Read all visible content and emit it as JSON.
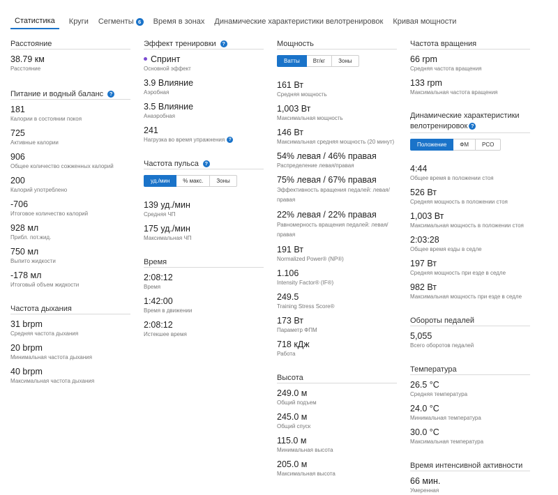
{
  "tabs": [
    {
      "label": "Статистика"
    },
    {
      "label": "Круги"
    },
    {
      "label": "Сегменты",
      "badge": "6"
    },
    {
      "label": "Время в зонах"
    },
    {
      "label": "Динамические характеристики велотренировок"
    },
    {
      "label": "Кривая мощности"
    }
  ],
  "help_glyph": "?",
  "col1": {
    "distance": {
      "title": "Расстояние",
      "value": "38.79 км",
      "label": "Расстояние"
    },
    "nutrition": {
      "title": "Питание и водный баланс",
      "items": [
        {
          "value": "181",
          "label": "Калории в состоянии покоя"
        },
        {
          "value": "725",
          "label": "Активные калории"
        },
        {
          "value": "906",
          "label": "Общее количество сожженных калорий"
        },
        {
          "value": "200",
          "label": "Калорий употреблено"
        },
        {
          "value": "-706",
          "label": "Итоговое количество калорий"
        },
        {
          "value": "928 мл",
          "label": "Прибл. пот.жид."
        },
        {
          "value": "750 мл",
          "label": "Выпито жидкости"
        },
        {
          "value": "-178 мл",
          "label": "Итоговый объем жидкости"
        }
      ]
    },
    "breathing": {
      "title": "Частота дыхания",
      "items": [
        {
          "value": "31 brpm",
          "label": "Средняя частота дыхания"
        },
        {
          "value": "20 brpm",
          "label": "Минимальная частота дыхания"
        },
        {
          "value": "40 brpm",
          "label": "Максимальная частота дыхания"
        }
      ]
    }
  },
  "col2": {
    "effect": {
      "title": "Эффект тренировки",
      "primary": {
        "value": "Спринт",
        "label": "Основной эффект"
      },
      "items": [
        {
          "value": "3.9 Влияние",
          "label": "Аэробная"
        },
        {
          "value": "3.5 Влияние",
          "label": "Анаэробная"
        },
        {
          "value": "241",
          "label": "Нагрузка во время упражнения"
        }
      ]
    },
    "hr": {
      "title": "Частота пульса",
      "buttons": [
        "уд./мин",
        "% макс.",
        "Зоны"
      ],
      "items": [
        {
          "value": "139 уд./мин",
          "label": "Средняя ЧП"
        },
        {
          "value": "175 уд./мин",
          "label": "Максимальная ЧП"
        }
      ]
    },
    "time": {
      "title": "Время",
      "items": [
        {
          "value": "2:08:12",
          "label": "Время"
        },
        {
          "value": "1:42:00",
          "label": "Время в движении"
        },
        {
          "value": "2:08:12",
          "label": "Истекшее время"
        }
      ]
    }
  },
  "col3": {
    "power": {
      "title": "Мощность",
      "buttons": [
        "Ватты",
        "Вт/кг",
        "Зоны"
      ],
      "items": [
        {
          "value": "161 Вт",
          "label": "Средняя мощность"
        },
        {
          "value": "1,003 Вт",
          "label": "Максимальная мощность"
        },
        {
          "value": "146 Вт",
          "label": "Максимальная средняя мощность (20 минут)"
        },
        {
          "value": "54% левая / 46% правая",
          "label": "Распределение левая/правая"
        },
        {
          "value": "75% левая / 67% правая",
          "label": "Эффективность вращения педалей: левая/правая"
        },
        {
          "value": "22% левая / 22% правая",
          "label": "Равномерность вращения педалей: левая/правая"
        },
        {
          "value": "191 Вт",
          "label": "Normalized Power® (NP®)"
        },
        {
          "value": "1.106",
          "label": "Intensity Factor® (IF®)"
        },
        {
          "value": "249.5",
          "label": "Training Stress Score®"
        },
        {
          "value": "173 Вт",
          "label": "Параметр ФПМ"
        },
        {
          "value": "718 кДж",
          "label": "Работа"
        }
      ]
    },
    "elevation": {
      "title": "Высота",
      "items": [
        {
          "value": "249.0 м",
          "label": "Общий подъем"
        },
        {
          "value": "245.0 м",
          "label": "Общий спуск"
        },
        {
          "value": "115.0 м",
          "label": "Минимальная высота"
        },
        {
          "value": "205.0 м",
          "label": "Максимальная высота"
        }
      ]
    }
  },
  "col4": {
    "cadence": {
      "title": "Частота вращения",
      "items": [
        {
          "value": "66 rpm",
          "label": "Средняя частота вращения"
        },
        {
          "value": "133 rpm",
          "label": "Максимальная частота вращения"
        }
      ]
    },
    "dynamics": {
      "title": "Динамические характеристики велотренировок",
      "buttons": [
        "Положение",
        "ФМ",
        "PCO"
      ],
      "items": [
        {
          "value": "4:44",
          "label": "Общее время в положении стоя"
        },
        {
          "value": "526 Вт",
          "label": "Средняя мощность в положении стоя"
        },
        {
          "value": "1,003 Вт",
          "label": "Максимальная мощность в положении стоя"
        },
        {
          "value": "2:03:28",
          "label": "Общее время езды в седле"
        },
        {
          "value": "197 Вт",
          "label": "Средняя мощность при езде в седле"
        },
        {
          "value": "982 Вт",
          "label": "Максимальная мощность при езде в седле"
        }
      ]
    },
    "strokes": {
      "title": "Обороты педалей",
      "items": [
        {
          "value": "5,055",
          "label": "Всего оборотов педалей"
        }
      ]
    },
    "temperature": {
      "title": "Температура",
      "items": [
        {
          "value": "26.5 °C",
          "label": "Средняя температура"
        },
        {
          "value": "24.0 °C",
          "label": "Минимальная температура"
        },
        {
          "value": "30.0 °C",
          "label": "Максимальная температура"
        }
      ]
    },
    "intensity": {
      "title": "Время интенсивной активности",
      "items": [
        {
          "value": "66 мин.",
          "label": "Умеренная"
        }
      ]
    }
  }
}
